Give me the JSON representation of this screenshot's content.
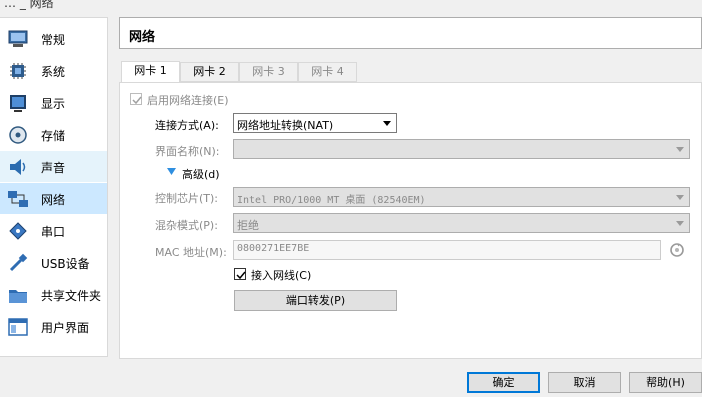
{
  "window": {
    "title_fragment": "… _ 网络"
  },
  "sidebar": {
    "items": [
      {
        "label": "常规",
        "icon": "monitor-icon"
      },
      {
        "label": "系统",
        "icon": "chip-icon"
      },
      {
        "label": "显示",
        "icon": "display-icon"
      },
      {
        "label": "存储",
        "icon": "disk-icon"
      },
      {
        "label": "声音",
        "icon": "speaker-icon"
      },
      {
        "label": "网络",
        "icon": "network-icon"
      },
      {
        "label": "串口",
        "icon": "serial-port-icon"
      },
      {
        "label": "USB设备",
        "icon": "usb-icon"
      },
      {
        "label": "共享文件夹",
        "icon": "folder-icon"
      },
      {
        "label": "用户界面",
        "icon": "ui-window-icon"
      }
    ]
  },
  "section_title": "网络",
  "tabs": [
    "网卡 1",
    "网卡 2",
    "网卡 3",
    "网卡 4"
  ],
  "form": {
    "enable_label": "启用网络连接(E)",
    "attached_label": "连接方式(A):",
    "attached_value": "网络地址转换(NAT)",
    "name_label": "界面名称(N):",
    "name_value": "",
    "advanced_label": "高级(d)",
    "adapter_label": "控制芯片(T):",
    "adapter_value": "Intel PRO/1000 MT 桌面 (82540EM)",
    "promisc_label": "混杂模式(P):",
    "promisc_value": "拒绝",
    "mac_label": "MAC 地址(M):",
    "mac_value": "0800271EE7BE",
    "cable_label": "接入网线(C)",
    "port_forward_label": "端口转发(P)"
  },
  "buttons": {
    "ok": "确定",
    "cancel": "取消",
    "help": "帮助(H)"
  },
  "colors": {
    "selected_bg": "#cce8ff",
    "hover_bg": "#e5f3fb",
    "default_button_border": "#0078d7",
    "disabled_text": "#8a8a8a"
  }
}
